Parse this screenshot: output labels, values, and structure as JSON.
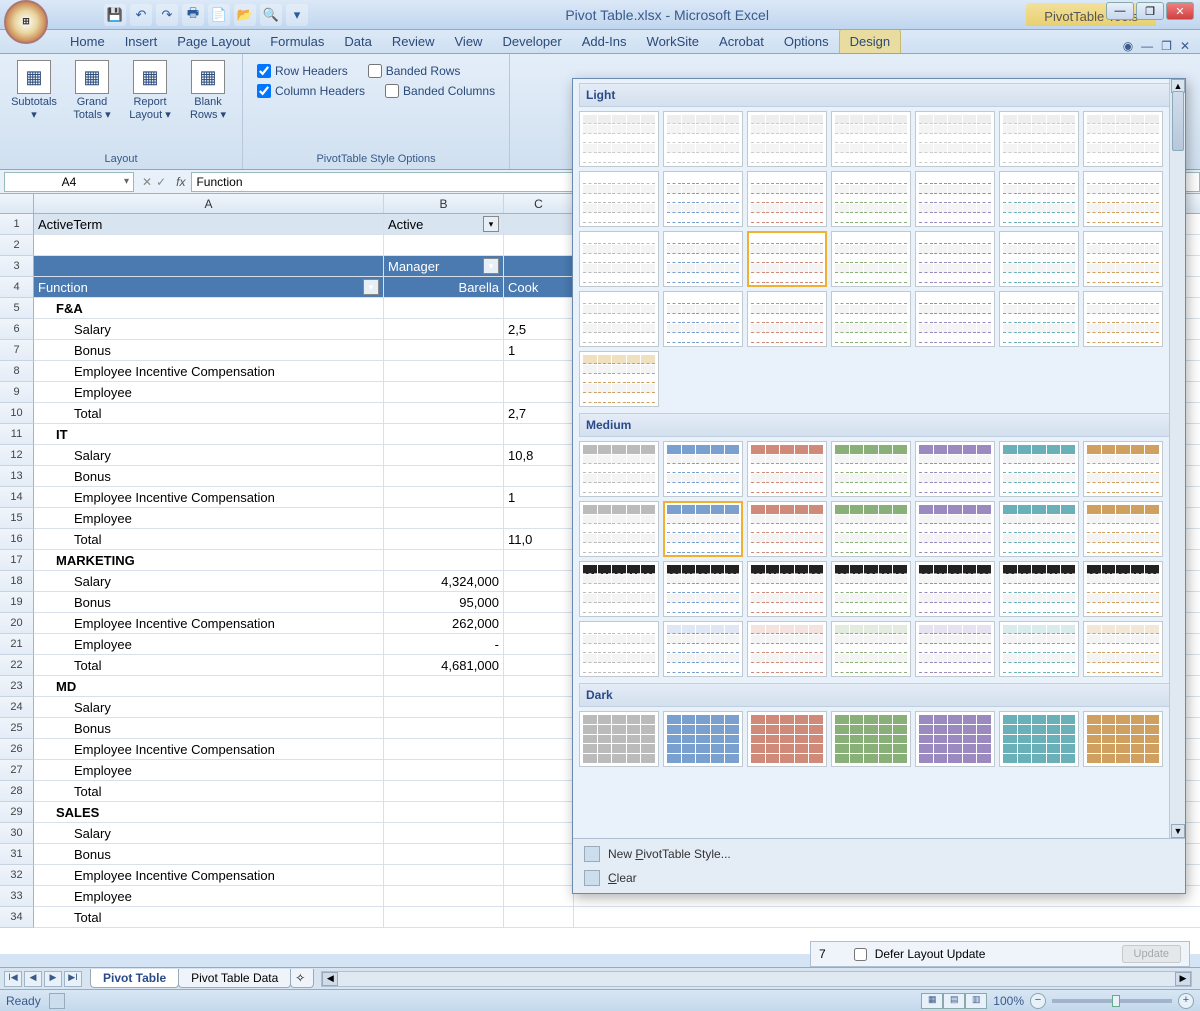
{
  "title": "Pivot Table.xlsx - Microsoft Excel",
  "context_tools": "PivotTable Tools",
  "qat": {
    "save": "💾",
    "undo": "↶",
    "redo": "↷",
    "print": "🖶",
    "preview": "📄",
    "open": "📂",
    "new": "🔍"
  },
  "tabs": [
    "Home",
    "Insert",
    "Page Layout",
    "Formulas",
    "Data",
    "Review",
    "View",
    "Developer",
    "Add-Ins",
    "WorkSite",
    "Acrobat",
    "Options",
    "Design"
  ],
  "ribbon": {
    "subtotals": "Subtotals",
    "grand_totals": "Grand Totals",
    "report_layout": "Report Layout",
    "blank_rows": "Blank Rows",
    "group_layout": "Layout",
    "row_headers": "Row Headers",
    "column_headers": "Column Headers",
    "banded_rows": "Banded Rows",
    "banded_columns": "Banded Columns",
    "group_style_options": "PivotTable Style Options"
  },
  "namebox": "A4",
  "fx": "fx",
  "formula": "Function",
  "cols": [
    "A",
    "B",
    "C"
  ],
  "rows": [
    {
      "n": 1,
      "a": "ActiveTerm",
      "b": "Active",
      "filter": true,
      "cls": "pvt-header light"
    },
    {
      "n": 2,
      "a": "",
      "b": ""
    },
    {
      "n": 3,
      "a": "",
      "b": "Manager",
      "dropdown_b": true,
      "cls": "pvt-header"
    },
    {
      "n": 4,
      "a": "Function",
      "b": "Barella",
      "c": "Cook",
      "dropdown_a": true,
      "cls": "pvt-header"
    },
    {
      "n": 5,
      "a": "F&A",
      "grp": true
    },
    {
      "n": 6,
      "a": "Salary",
      "b": "",
      "c": "2,5",
      "indent": 2
    },
    {
      "n": 7,
      "a": "Bonus",
      "b": "",
      "c": "1",
      "indent": 2
    },
    {
      "n": 8,
      "a": "Employee Incentive Compensation",
      "indent": 2
    },
    {
      "n": 9,
      "a": "Employee",
      "indent": 2
    },
    {
      "n": 10,
      "a": "Total",
      "b": "",
      "c": "2,7",
      "indent": 2
    },
    {
      "n": 11,
      "a": "IT",
      "grp": true
    },
    {
      "n": 12,
      "a": "Salary",
      "b": "",
      "c": "10,8",
      "indent": 2
    },
    {
      "n": 13,
      "a": "Bonus",
      "indent": 2
    },
    {
      "n": 14,
      "a": "Employee Incentive Compensation",
      "b": "",
      "c": "1",
      "indent": 2
    },
    {
      "n": 15,
      "a": "Employee",
      "indent": 2
    },
    {
      "n": 16,
      "a": "Total",
      "b": "",
      "c": "11,0",
      "indent": 2
    },
    {
      "n": 17,
      "a": "MARKETING",
      "grp": true
    },
    {
      "n": 18,
      "a": "Salary",
      "b": "4,324,000",
      "indent": 2
    },
    {
      "n": 19,
      "a": "Bonus",
      "b": "95,000",
      "indent": 2
    },
    {
      "n": 20,
      "a": "Employee Incentive Compensation",
      "b": "262,000",
      "indent": 2
    },
    {
      "n": 21,
      "a": "Employee",
      "b": "-",
      "indent": 2
    },
    {
      "n": 22,
      "a": "Total",
      "b": "4,681,000",
      "indent": 2
    },
    {
      "n": 23,
      "a": "MD",
      "grp": true
    },
    {
      "n": 24,
      "a": "Salary",
      "indent": 2
    },
    {
      "n": 25,
      "a": "Bonus",
      "indent": 2
    },
    {
      "n": 26,
      "a": "Employee Incentive Compensation",
      "indent": 2
    },
    {
      "n": 27,
      "a": "Employee",
      "indent": 2
    },
    {
      "n": 28,
      "a": "Total",
      "indent": 2
    },
    {
      "n": 29,
      "a": "SALES",
      "grp": true
    },
    {
      "n": 30,
      "a": "Salary",
      "indent": 2
    },
    {
      "n": 31,
      "a": "Bonus",
      "indent": 2
    },
    {
      "n": 32,
      "a": "Employee Incentive Compensation",
      "indent": 2
    },
    {
      "n": 33,
      "a": "Employee",
      "indent": 2
    },
    {
      "n": 34,
      "a": "Total",
      "indent": 2
    }
  ],
  "gallery": {
    "light": "Light",
    "medium": "Medium",
    "dark": "Dark",
    "new_style": "New PivotTable Style...",
    "clear": "Clear"
  },
  "sheets": {
    "active": "Pivot Table",
    "other": "Pivot Table Data"
  },
  "seven": "7",
  "defer": "Defer Layout Update",
  "update": "Update",
  "status": "Ready",
  "zoom": "100%",
  "winbtns": {
    "min": "—",
    "max": "❐",
    "close": "✕"
  }
}
